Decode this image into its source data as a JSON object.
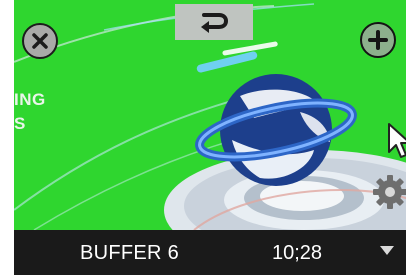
{
  "preview": {
    "overlay_text_line1": "ING",
    "overlay_text_line2": "S"
  },
  "controls": {
    "top_button_icon": "undo-arrow-icon",
    "close_icon": "close-icon",
    "add_icon": "plus-icon",
    "settings_icon": "gear-icon"
  },
  "status_bar": {
    "buffer_name": "BUFFER 6",
    "time": "10;28",
    "dropdown_icon": "chevron-down-icon"
  },
  "colors": {
    "background_green": "#2fd62f",
    "status_bar_bg": "#1a1a1a"
  }
}
